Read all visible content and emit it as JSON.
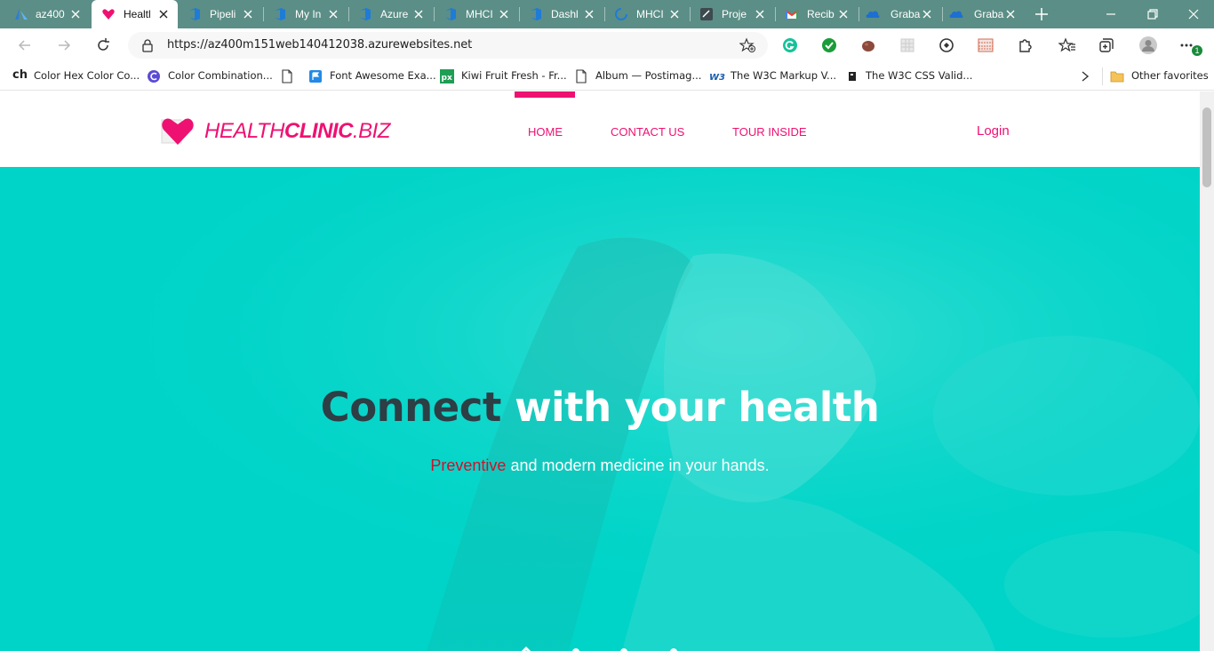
{
  "browser": {
    "tabs": [
      {
        "title": "az400",
        "icon": "azure-icon",
        "active": false
      },
      {
        "title": "Healtl",
        "icon": "heart-icon",
        "active": true
      },
      {
        "title": "Pipeli",
        "icon": "devops-icon",
        "active": false
      },
      {
        "title": "My In",
        "icon": "devops-icon",
        "active": false
      },
      {
        "title": "Azure",
        "icon": "devops-icon",
        "active": false
      },
      {
        "title": "MHCI",
        "icon": "devops-icon",
        "active": false
      },
      {
        "title": "Dashl",
        "icon": "devops-icon",
        "active": false
      },
      {
        "title": "MHCI",
        "icon": "devops-icon",
        "active": false
      },
      {
        "title": "Proje",
        "icon": "project-icon",
        "active": false
      },
      {
        "title": "Recib",
        "icon": "gmail-icon",
        "active": false
      },
      {
        "title": "Graba",
        "icon": "onedrive-icon",
        "active": false
      },
      {
        "title": "Graba",
        "icon": "onedrive-icon",
        "active": false
      }
    ],
    "url": "https://az400m151web140412038.azurewebsites.net",
    "extensions_badge": "1",
    "bookmarks": [
      {
        "label": "Color Hex Color Co...",
        "icon": "ch-icon",
        "badge": "ch"
      },
      {
        "label": "Color Combination...",
        "icon": "c-icon"
      },
      {
        "label": "",
        "icon": "page-icon"
      },
      {
        "label": "Font Awesome Exa...",
        "icon": "flag-icon"
      },
      {
        "label": "Kiwi Fruit Fresh - Fr...",
        "icon": "px-icon"
      },
      {
        "label": "Album — Postimag...",
        "icon": "page-icon"
      },
      {
        "label": "The W3C Markup V...",
        "icon": "w3c-icon"
      },
      {
        "label": "The W3C CSS Valid...",
        "icon": "w3c-css-icon"
      }
    ],
    "other_favorites": "Other favorites"
  },
  "site": {
    "logo": {
      "part1": "HEALTH",
      "part2": "CLINIC",
      "part3": ".BIZ"
    },
    "nav": {
      "home": "HOME",
      "contact": "CONTACT US",
      "tour": "TOUR INSIDE"
    },
    "login": "Login",
    "hero": {
      "title_part1": "Connect",
      "title_part2": "with your health",
      "subtitle_accent": "Preventive",
      "subtitle_rest": "and modern medicine in your hands."
    }
  },
  "colors": {
    "brand": "#ee1172",
    "hero_bg": "#00d4c8",
    "title_dark": "#2d3e45",
    "accent_red": "#d0102c",
    "tabstrip": "#5b8e86"
  }
}
